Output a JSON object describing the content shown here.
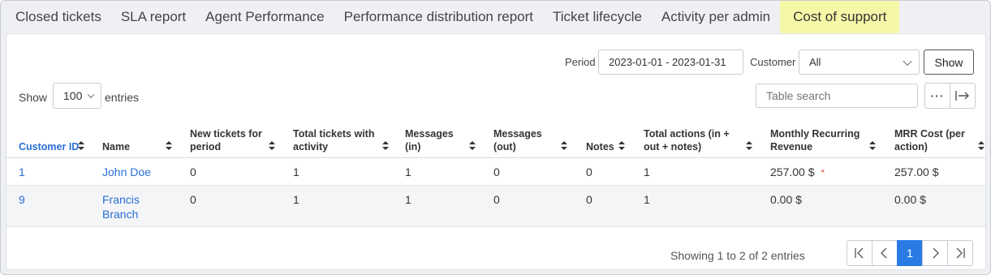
{
  "tabs": [
    {
      "label": "Closed tickets"
    },
    {
      "label": "SLA report"
    },
    {
      "label": "Agent Performance"
    },
    {
      "label": "Performance distribution report"
    },
    {
      "label": "Ticket lifecycle"
    },
    {
      "label": "Activity per admin"
    },
    {
      "label": "Cost of support"
    }
  ],
  "active_tab": "Cost of support",
  "filters": {
    "period_label": "Period",
    "period_value": "2023-01-01 - 2023-01-31",
    "customer_label": "Customer",
    "customer_value": "All",
    "show_button": "Show"
  },
  "length": {
    "show_label": "Show",
    "value": "100",
    "entries_label": "entries"
  },
  "search": {
    "placeholder": "Table search"
  },
  "columns": [
    "Customer ID",
    "Name",
    "New tickets for period",
    "Total tickets with activity",
    "Messages (in)",
    "Messages (out)",
    "Notes",
    "Total actions (in + out + notes)",
    "Monthly Recurring Revenue",
    "MRR Cost (per action)"
  ],
  "rows": [
    {
      "id": "1",
      "name": "John Doe",
      "new_tickets": "0",
      "total_tickets": "1",
      "msg_in": "1",
      "msg_out": "0",
      "notes": "0",
      "total_actions": "1",
      "mrr": "257.00 $",
      "mrr_marker": "*",
      "mrr_cost": "257.00 $"
    },
    {
      "id": "9",
      "name": "Francis Branch",
      "new_tickets": "0",
      "total_tickets": "1",
      "msg_in": "1",
      "msg_out": "0",
      "notes": "0",
      "total_actions": "1",
      "mrr": "0.00 $",
      "mrr_marker": "",
      "mrr_cost": "0.00 $"
    }
  ],
  "footer": {
    "info": "Showing 1 to 2 of 2 entries",
    "current_page": "1"
  },
  "colors": {
    "accent": "#2b7be4",
    "link": "#2a6fd6",
    "active_tab_bg": "#f7f7a8"
  },
  "icons": [
    "more-icon",
    "export-icon",
    "first-page-icon",
    "prev-page-icon",
    "next-page-icon",
    "last-page-icon",
    "sort-icon",
    "chevron-down-icon"
  ]
}
